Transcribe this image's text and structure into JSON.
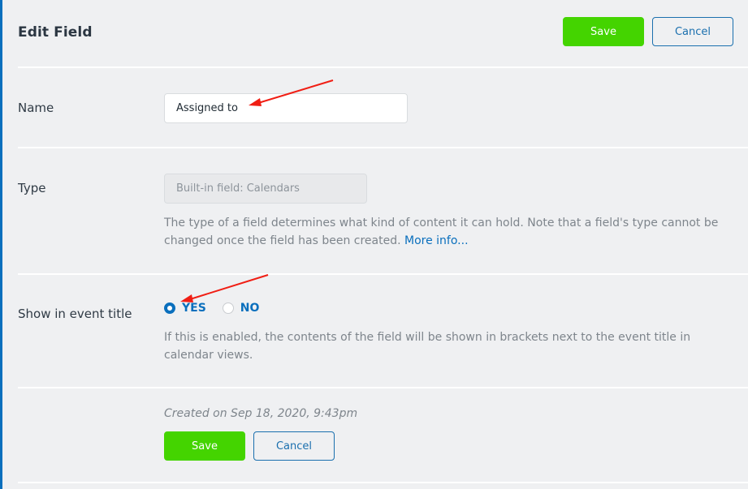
{
  "header": {
    "title": "Edit Field",
    "save_label": "Save",
    "cancel_label": "Cancel"
  },
  "fields": {
    "name": {
      "label": "Name",
      "value": "Assigned to"
    },
    "type": {
      "label": "Type",
      "value": "Built-in field: Calendars",
      "help": "The type of a field determines what kind of content it can hold. Note that a field's type cannot be changed once the field has been created.",
      "help_link": "More info..."
    },
    "show_in_event_title": {
      "label": "Show in event title",
      "options": [
        {
          "label": "YES",
          "checked": true
        },
        {
          "label": "NO",
          "checked": false
        }
      ],
      "help": "If this is enabled, the contents of the field will be shown in brackets next to the event title in calendar views."
    }
  },
  "footer": {
    "created": "Created on Sep 18, 2020, 9:43pm",
    "save_label": "Save",
    "cancel_label": "Cancel"
  },
  "colors": {
    "accent": "#0a6fbd",
    "save_green": "#44d400",
    "annotation_arrow": "#ff0000"
  }
}
